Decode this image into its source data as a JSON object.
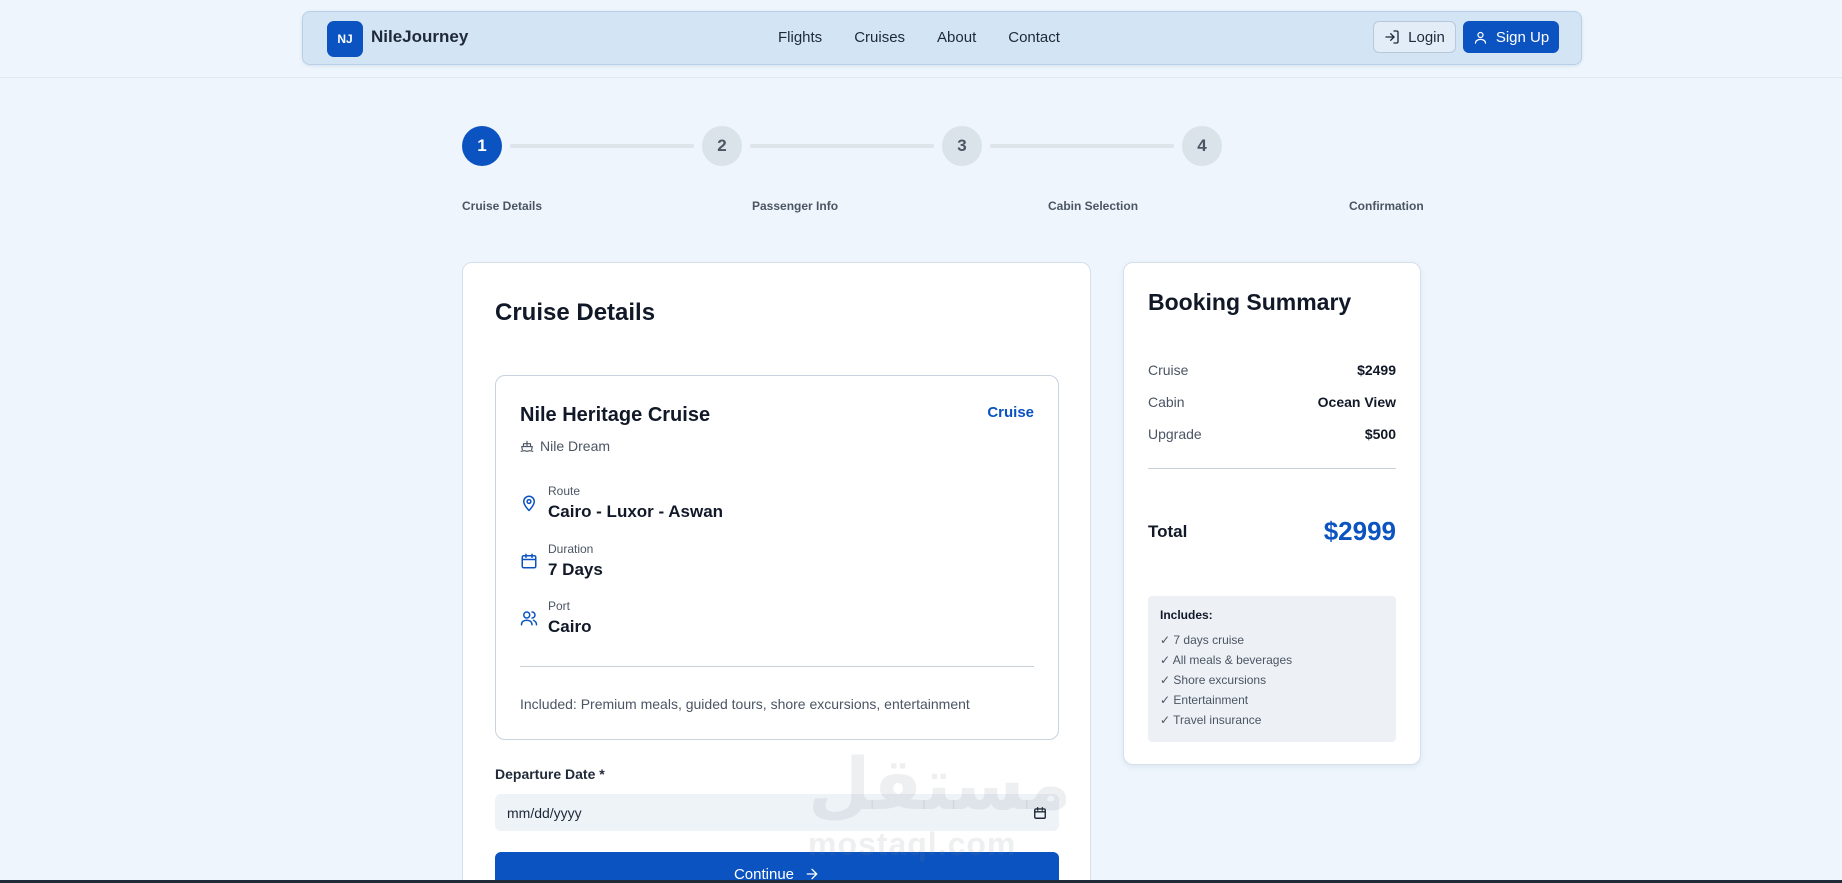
{
  "navbar": {
    "logo_text": "NJ",
    "brand": "NileJourney",
    "links": [
      "Flights",
      "Cruises",
      "About",
      "Contact"
    ],
    "login_label": "Login",
    "signup_label": "Sign Up"
  },
  "stepper": {
    "current_step": 1,
    "steps": [
      {
        "number": "1",
        "label": "Cruise Details"
      },
      {
        "number": "2",
        "label": "Passenger Info"
      },
      {
        "number": "3",
        "label": "Cabin Selection"
      },
      {
        "number": "4",
        "label": "Confirmation"
      }
    ]
  },
  "main": {
    "title": "Cruise Details",
    "cruise": {
      "name": "Nile Heritage Cruise",
      "tag": "Cruise",
      "ship": "Nile Dream",
      "route_label": "Route",
      "route_value": "Cairo - Luxor - Aswan",
      "duration_label": "Duration",
      "duration_value": "7 Days",
      "port_label": "Port",
      "port_value": "Cairo",
      "included": "Included: Premium meals, guided tours, shore excursions, entertainment"
    },
    "departure_label": "Departure Date *",
    "departure_placeholder": "mm/dd/yyyy",
    "continue_label": "Continue"
  },
  "summary": {
    "title": "Booking Summary",
    "rows": [
      {
        "key": "Cruise",
        "value": "$2499"
      },
      {
        "key": "Cabin",
        "value": "Ocean View"
      },
      {
        "key": "Upgrade",
        "value": "$500"
      }
    ],
    "total_label": "Total",
    "total_value": "$2999",
    "includes_title": "Includes:",
    "includes": [
      "✓ 7 days cruise",
      "✓ All meals & beverages",
      "✓ Shore excursions",
      "✓ Entertainment",
      "✓ Travel insurance"
    ]
  },
  "watermark": {
    "arabic": "مستقل",
    "latin": "mostaql.com"
  },
  "colors": {
    "primary": "#0b53c1",
    "background": "#eef5fc",
    "navbar": "#d3e5f5"
  }
}
